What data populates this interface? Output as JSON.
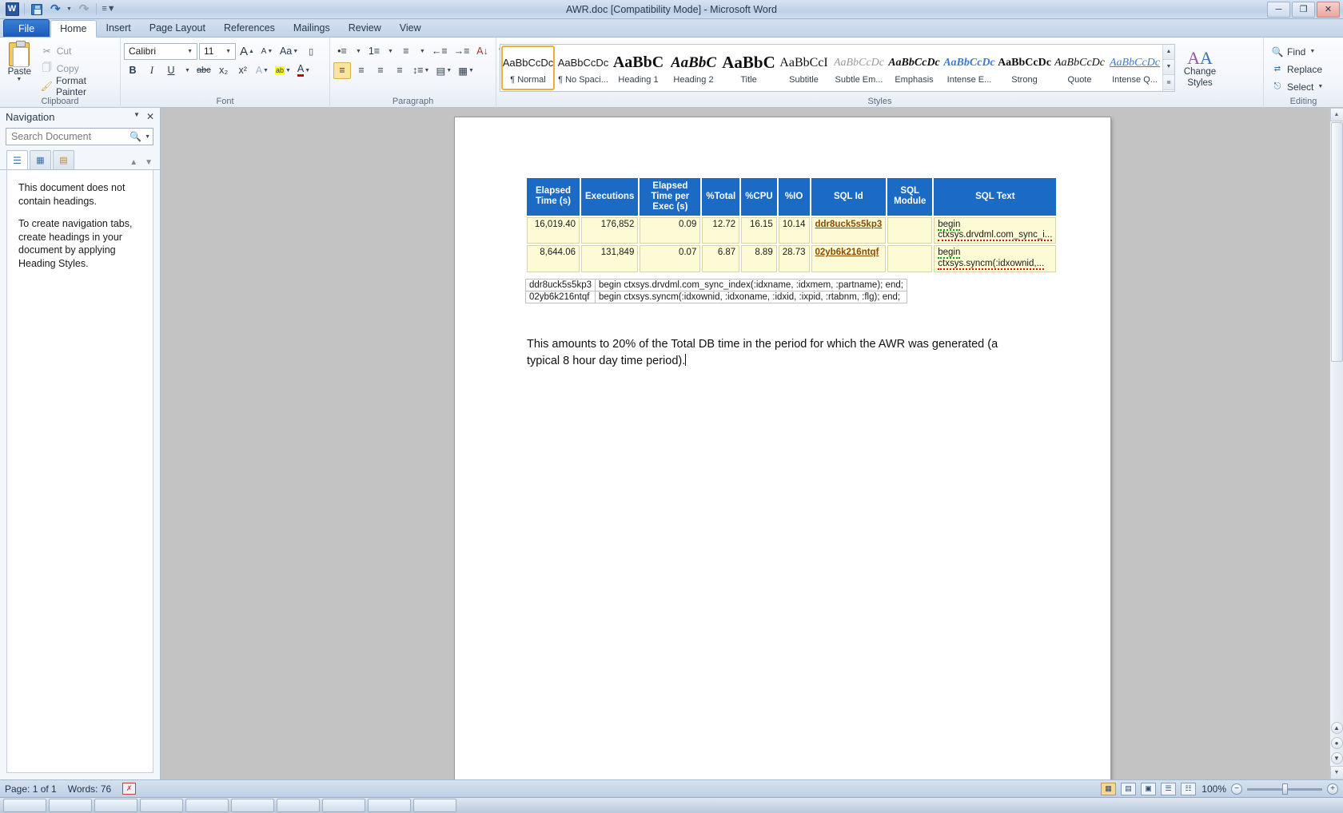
{
  "window": {
    "title": "AWR.doc [Compatibility Mode]  -  Microsoft Word",
    "logo": "W",
    "minimize": "─",
    "restore": "❐",
    "close": "✕"
  },
  "qat": {
    "save": "save-icon",
    "undo": "undo-icon",
    "redo": "redo-icon",
    "customize": "customize-qat-icon"
  },
  "tabs": [
    {
      "label": "File",
      "type": "file"
    },
    {
      "label": "Home",
      "type": "active"
    },
    {
      "label": "Insert",
      "type": "normal"
    },
    {
      "label": "Page Layout",
      "type": "normal"
    },
    {
      "label": "References",
      "type": "normal"
    },
    {
      "label": "Mailings",
      "type": "normal"
    },
    {
      "label": "Review",
      "type": "normal"
    },
    {
      "label": "View",
      "type": "normal"
    }
  ],
  "ribbon": {
    "clipboard": {
      "label": "Clipboard",
      "paste": "Paste",
      "cut": "Cut",
      "copy": "Copy",
      "format_painter": "Format Painter"
    },
    "font": {
      "label": "Font",
      "font_name": "Calibri",
      "font_size": "11",
      "grow": "A",
      "shrink": "A",
      "change_case": "Aa",
      "clear_formatting": "A⃠",
      "bold": "B",
      "italic": "I",
      "underline": "U",
      "strikethrough": "abc",
      "subscript": "x₂",
      "superscript": "x²",
      "text_effects": "A",
      "highlight": "ab",
      "font_color": "A"
    },
    "paragraph": {
      "label": "Paragraph",
      "bullets": "•≡",
      "numbering": "1≡",
      "multilevel": "≡",
      "decrease_indent": "←≡",
      "increase_indent": "→≡",
      "sort": "A↓",
      "show_marks": "¶",
      "align_left": "≡",
      "align_center": "≡",
      "align_right": "≡",
      "justify": "≡",
      "line_spacing": "↕≡",
      "shading": "▤",
      "borders": "▦"
    },
    "styles": {
      "label": "Styles",
      "items": [
        {
          "preview": "AaBbCcDc",
          "name": "¶ Normal",
          "style": "normal",
          "selected": true
        },
        {
          "preview": "AaBbCcDc",
          "name": "¶ No Spaci...",
          "style": "normal",
          "selected": false
        },
        {
          "preview": "AaBbC",
          "name": "Heading 1",
          "style": "h1",
          "selected": false
        },
        {
          "preview": "AaBbC",
          "name": "Heading 2",
          "style": "h2",
          "selected": false
        },
        {
          "preview": "AaBbC",
          "name": "Title",
          "style": "title",
          "selected": false
        },
        {
          "preview": "AaBbCcI",
          "name": "Subtitle",
          "style": "subtitle",
          "selected": false
        },
        {
          "preview": "AaBbCcDc",
          "name": "Subtle Em...",
          "style": "subtle-em",
          "selected": false
        },
        {
          "preview": "AaBbCcDc",
          "name": "Emphasis",
          "style": "emphasis",
          "selected": false
        },
        {
          "preview": "AaBbCcDc",
          "name": "Intense E...",
          "style": "intense-em",
          "selected": false
        },
        {
          "preview": "AaBbCcDc",
          "name": "Strong",
          "style": "strong",
          "selected": false
        },
        {
          "preview": "AaBbCcDc",
          "name": "Quote",
          "style": "quote",
          "selected": false
        },
        {
          "preview": "AaBbCcDc",
          "name": "Intense Q...",
          "style": "intense-q",
          "selected": false
        }
      ],
      "change_styles": "Change\nStyles"
    },
    "editing": {
      "label": "Editing",
      "find": "Find",
      "replace": "Replace",
      "select": "Select"
    }
  },
  "navigation": {
    "title": "Navigation",
    "search_placeholder": "Search Document",
    "search_value": "",
    "tabs": [
      "headings-tab",
      "pages-tab",
      "results-tab"
    ],
    "empty_line_1": "This document does not contain headings.",
    "empty_line_2": "To create navigation tabs, create headings in your document by applying Heading Styles."
  },
  "document": {
    "awr_table": {
      "headers": [
        "Elapsed Time (s)",
        "Executions",
        "Elapsed Time per Exec (s)",
        "%Total",
        "%CPU",
        "%IO",
        "SQL Id",
        "SQL Module",
        "SQL Text"
      ],
      "rows": [
        {
          "elapsed_time": "16,019.40",
          "executions": "176,852",
          "elapsed_per_exec": "0.09",
          "pct_total": "12.72",
          "pct_cpu": "16.15",
          "pct_io": "10.14",
          "sql_id": "ddr8uck5s5kp3",
          "sql_module": "",
          "sql_text_line1": "begin",
          "sql_text_line2": "ctxsys.drvdml.com_sync_i..."
        },
        {
          "elapsed_time": "8,644.06",
          "executions": "131,849",
          "elapsed_per_exec": "0.07",
          "pct_total": "6.87",
          "pct_cpu": "8.89",
          "pct_io": "28.73",
          "sql_id": "02yb6k216ntqf",
          "sql_module": "",
          "sql_text_line1": "begin",
          "sql_text_line2": "ctxsys.syncm(:idxownid,..."
        }
      ]
    },
    "sql_table": {
      "rows": [
        {
          "id": "ddr8uck5s5kp3",
          "text": "begin ctxsys.drvdml.com_sync_index(:idxname, :idxmem, :partname); end;"
        },
        {
          "id": "02yb6k216ntqf",
          "text": "begin ctxsys.syncm(:idxownid, :idxoname, :idxid, :ixpid, :rtabnm, :flg); end;"
        }
      ]
    },
    "paragraph": "This amounts to 20% of the Total DB time in the period for which the AWR was generated (a typical 8 hour day time period)."
  },
  "statusbar": {
    "page": "Page: 1 of 1",
    "words": "Words: 76",
    "proofing": "proofing-errors-icon",
    "views": [
      "print-layout",
      "full-screen-reading",
      "web-layout",
      "outline",
      "draft"
    ],
    "zoom": "100%",
    "zoom_out": "−",
    "zoom_in": "+"
  },
  "colors": {
    "header_blue": "#1b6bc4",
    "cell_yellow": "#fdfbd6",
    "accent_orange": "#e8b23a",
    "file_tab_blue": "#2b579a"
  }
}
